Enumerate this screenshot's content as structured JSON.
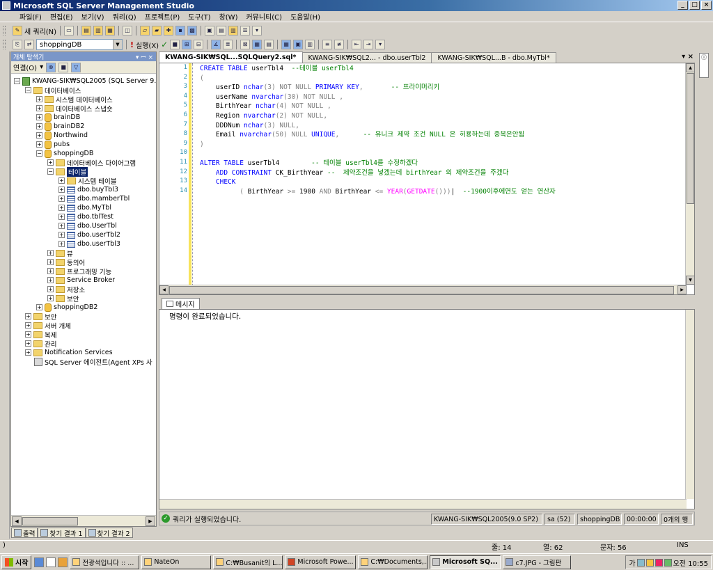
{
  "window": {
    "title": "Microsoft SQL Server Management Studio"
  },
  "menu": [
    "파일(F)",
    "편집(E)",
    "보기(V)",
    "쿼리(Q)",
    "프로젝트(P)",
    "도구(T)",
    "창(W)",
    "커뮤니티(C)",
    "도움말(H)"
  ],
  "toolbar": {
    "new_query": "새 쿼리(N)",
    "database": "shoppingDB",
    "execute": "실행(X)"
  },
  "object_explorer": {
    "title": "개체 탐색기",
    "connect": "연결(O)",
    "server": "KWANG-SIK₩SQL2005 (SQL Server 9.",
    "databases": "데이터베이스",
    "system_databases": "시스템 데이터베이스",
    "snapshots": "데이터베이스 스냅숏",
    "db_list": [
      "brainDB",
      "brainDB2",
      "Northwind",
      "pubs",
      "shoppingDB"
    ],
    "diagrams": "데이터베이스 다이어그램",
    "tables": "테이블",
    "system_tables": "시스템 테이블",
    "table_list": [
      "dbo.buyTbl3",
      "dbo.mamberTbl",
      "dbo.MyTbl",
      "dbo.tblTest",
      "dbo.UserTbl",
      "dbo.userTbl2",
      "dbo.userTbl3"
    ],
    "shopping_children": [
      "뷰",
      "동의어",
      "프로그래밍 기능",
      "Service Broker",
      "저장소",
      "보안"
    ],
    "shoppingdb2": "shoppingDB2",
    "server_children": [
      "보안",
      "서버 개체",
      "복제",
      "관리",
      "Notification Services"
    ],
    "agent": "SQL Server 에이전트(Agent XPs 사"
  },
  "tabs": [
    "KWANG-SIK₩SQL...SQLQuery2.sql*",
    "KWANG-SIK₩SQL2... - dbo.userTbl2",
    "KWANG-SIK₩SQL...B - dbo.MyTbl*"
  ],
  "editor": {
    "lines": [
      [
        [
          "kw",
          "CREATE TABLE "
        ],
        [
          "t",
          "userTbl4  "
        ],
        [
          "cm",
          "--테이블 userTbl4"
        ]
      ],
      [
        [
          "gr",
          "("
        ]
      ],
      [
        [
          "t",
          "    userID "
        ],
        [
          "ty",
          "nchar"
        ],
        [
          "gr",
          "(3) NOT NULL "
        ],
        [
          "kw",
          "PRIMARY KEY"
        ],
        [
          "gr",
          ","
        ],
        [
          "t",
          "       "
        ],
        [
          "cm",
          "-- 프라이머리키"
        ]
      ],
      [
        [
          "t",
          "    userName "
        ],
        [
          "ty",
          "nvarchar"
        ],
        [
          "gr",
          "(30) NOT NULL ,"
        ]
      ],
      [
        [
          "t",
          "    BirthYear "
        ],
        [
          "ty",
          "nchar"
        ],
        [
          "gr",
          "(4) NOT NULL ,"
        ]
      ],
      [
        [
          "t",
          "    Region "
        ],
        [
          "ty",
          "nvarchar"
        ],
        [
          "gr",
          "(2) NOT NULL,"
        ]
      ],
      [
        [
          "t",
          "    DDDNum "
        ],
        [
          "ty",
          "nchar"
        ],
        [
          "gr",
          "(3) NULL,"
        ]
      ],
      [
        [
          "t",
          "    Email "
        ],
        [
          "ty",
          "nvarchar"
        ],
        [
          "gr",
          "(50) NULL "
        ],
        [
          "kw",
          "UNIQUE"
        ],
        [
          "gr",
          ","
        ],
        [
          "t",
          "      "
        ],
        [
          "cm",
          "-- 유니크 제약 조건 NULL 은 허용하는데 중복은안됨"
        ]
      ],
      [
        [
          "gr",
          ")"
        ]
      ],
      [
        [
          "t",
          ""
        ]
      ],
      [
        [
          "kw",
          "ALTER TABLE "
        ],
        [
          "t",
          "userTbl4        "
        ],
        [
          "cm",
          "-- 테이블 userTbl4를 수정하겠다"
        ]
      ],
      [
        [
          "t",
          "    "
        ],
        [
          "kw",
          "ADD CONSTRAINT "
        ],
        [
          "t",
          "CK_BirthYear "
        ],
        [
          "cm",
          "--  제약조건을 넣겠는데 birthYear 의 제약조건을 주겠다"
        ]
      ],
      [
        [
          "t",
          "    "
        ],
        [
          "kw",
          "CHECK"
        ]
      ],
      [
        [
          "t",
          "          "
        ],
        [
          "gr",
          "( "
        ],
        [
          "t",
          "BirthYear "
        ],
        [
          "gr",
          ">= "
        ],
        [
          "t",
          "1900 "
        ],
        [
          "gr",
          "AND "
        ],
        [
          "t",
          "BirthYear "
        ],
        [
          "gr",
          "<= "
        ],
        [
          "fn",
          "YEAR"
        ],
        [
          "gr",
          "("
        ],
        [
          "fn",
          "GETDATE"
        ],
        [
          "gr",
          "()))"
        ],
        [
          "t",
          "|  "
        ],
        [
          "cm",
          "--1900이후에연도 얻는 연산자"
        ]
      ]
    ]
  },
  "messages": {
    "tab": "메시지",
    "text": "명령이 완료되었습니다."
  },
  "query_status": {
    "text": "쿼리가 실행되었습니다.",
    "server": "KWANG-SIK₩SQL2005(9.0 SP2)",
    "user": "sa (52)",
    "db": "shoppingDB",
    "time": "00:00:00",
    "rows": "0개의 행"
  },
  "output_tabs": [
    "출력",
    "찾기 결과 1",
    "찾기 결과 2"
  ],
  "statusbar": {
    "left": ")",
    "line": "줄: 14",
    "col": "열: 62",
    "ch": "문자: 56",
    "mode": "INS"
  },
  "taskbar": {
    "start": "시작",
    "items": [
      "전광석입니다 :: ...",
      "NateOn",
      "C:₩Busanit의 L...",
      "Microsoft Powe...",
      "C:₩Documents,...",
      "Microsoft SQ...",
      "c7.JPG - 그림판"
    ],
    "ime": "가",
    "clock": "오전 10:55"
  }
}
